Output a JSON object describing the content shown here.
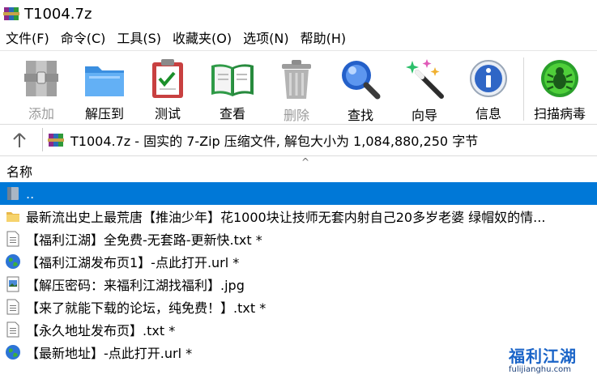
{
  "window": {
    "title": "T1004.7z"
  },
  "menu": [
    "文件(F)",
    "命令(C)",
    "工具(S)",
    "收藏夹(O)",
    "选项(N)",
    "帮助(H)"
  ],
  "toolbar": [
    {
      "label": "添加",
      "icon": "archive-add-icon",
      "enabled": false
    },
    {
      "label": "解压到",
      "icon": "folder-extract-icon",
      "enabled": true
    },
    {
      "label": "测试",
      "icon": "clipboard-check-icon",
      "enabled": true
    },
    {
      "label": "查看",
      "icon": "book-view-icon",
      "enabled": true
    },
    {
      "label": "删除",
      "icon": "trash-icon",
      "enabled": false
    },
    {
      "label": "查找",
      "icon": "magnifier-icon",
      "enabled": true
    },
    {
      "label": "向导",
      "icon": "wizard-wand-icon",
      "enabled": true
    },
    {
      "label": "信息",
      "icon": "info-icon",
      "enabled": true
    },
    {
      "label": "扫描病毒",
      "icon": "virus-scan-icon",
      "enabled": true
    }
  ],
  "address": {
    "text": "T1004.7z - 固实的 7-Zip 压缩文件, 解包大小为 1,084,880,250 字节"
  },
  "list": {
    "column_name": "名称",
    "rows": [
      {
        "name": "..",
        "icon": "parent-folder-icon",
        "selected": true
      },
      {
        "name": "最新流出史上最荒唐【推油少年】花1000块让技师无套内射自己20多岁老婆 绿帽奴的情...",
        "icon": "folder-icon",
        "selected": false
      },
      {
        "name": "【福利江湖】全免费-无套路-更新快.txt *",
        "icon": "text-file-icon",
        "selected": false
      },
      {
        "name": "【福利江湖发布页1】-点此打开.url *",
        "icon": "globe-url-icon",
        "selected": false
      },
      {
        "name": "【解压密码：来福利江湖找福利】.jpg",
        "icon": "image-file-icon",
        "selected": false
      },
      {
        "name": "【来了就能下载的论坛，纯免费！】.txt *",
        "icon": "text-file-icon",
        "selected": false
      },
      {
        "name": "【永久地址发布页】.txt *",
        "icon": "text-file-icon",
        "selected": false
      },
      {
        "name": "【最新地址】-点此打开.url *",
        "icon": "globe-url-icon",
        "selected": false
      }
    ]
  },
  "watermark": {
    "main": "福利江湖",
    "sub": "fulijianghu.com"
  },
  "colors": {
    "selection": "#0078d7",
    "disabled_text": "#9a9a9a"
  }
}
